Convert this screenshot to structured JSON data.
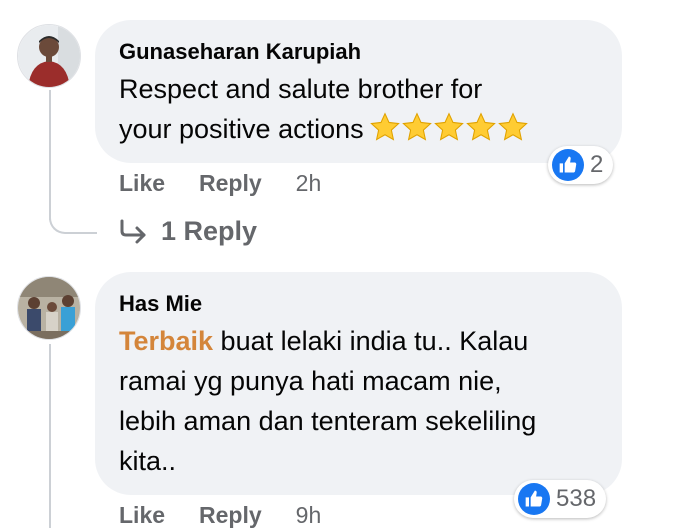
{
  "comments": [
    {
      "author": "Gunaseharan Karupiah",
      "text_lines": [
        "Respect and salute brother for",
        "your positive actions"
      ],
      "emoji": "star-emoji x5",
      "reaction_count": "2",
      "actions": {
        "like": "Like",
        "reply": "Reply",
        "time": "2h"
      },
      "replies_link": "1 Reply"
    },
    {
      "author": "Has Mie",
      "highlight_word": "Terbaik",
      "text_first_rest": " buat lelaki india tu.. Kalau",
      "text_lines": [
        "ramai yg punya hati macam nie,",
        "lebih aman dan tenteram sekeliling",
        "kita.."
      ],
      "reaction_count": "538",
      "actions": {
        "like": "Like",
        "reply": "Reply",
        "time": "9h"
      }
    }
  ],
  "colors": {
    "bubble": "#f0f2f5",
    "like_blue": "#1877f2",
    "meta_gray": "#65676b",
    "keyword": "#d4853a"
  }
}
